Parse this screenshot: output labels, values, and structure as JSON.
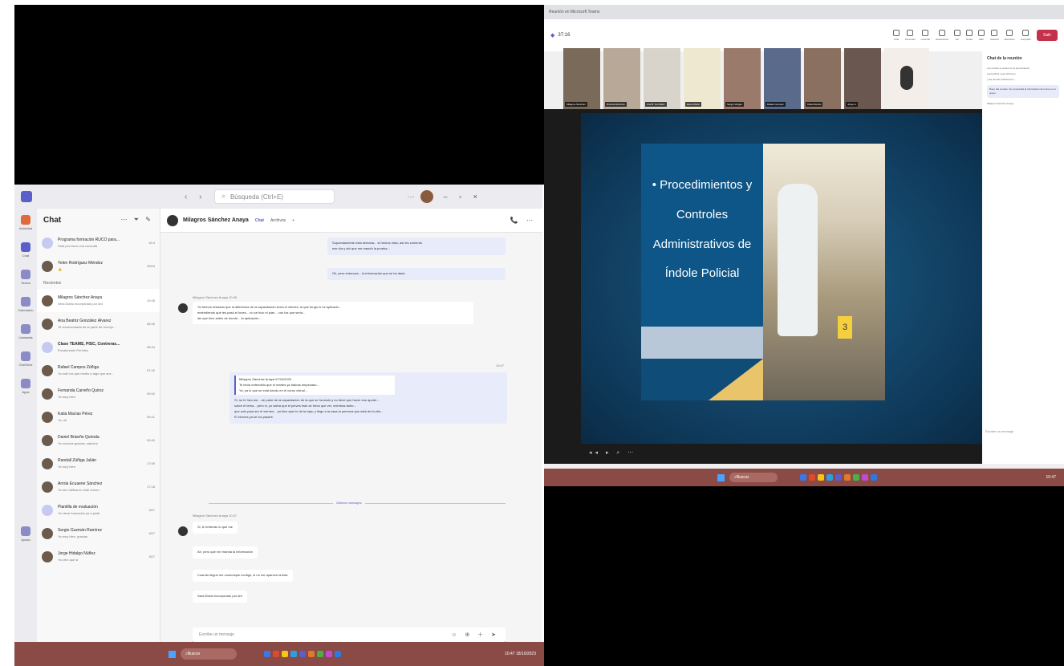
{
  "left_window": {
    "search_placeholder": "Búsqueda (Ctrl+E)",
    "rail": [
      "Actividad",
      "Chat",
      "Teams",
      "Calendario",
      "Llamadas",
      "OneDrive",
      "Apps",
      "Ayuda"
    ],
    "chat_list": {
      "title": "Chat",
      "section_recent": "Recientes",
      "items": [
        {
          "name": "Programa formación RUCO para...",
          "preview": "Hola por favor una consulta",
          "time": "16:4"
        },
        {
          "name": "Yelen Rodríguez Méndez",
          "preview": "👍",
          "time": "09/04"
        },
        {
          "name": "Milagros Sánchez Anaya",
          "preview": "Sera Diario incorporado por ahí",
          "time": "10:45",
          "selected": true
        },
        {
          "name": "Ana Beatriz González Álvarez",
          "preview": "Te recomendado de la parte de Ucenjo...",
          "time": "08:30"
        },
        {
          "name": "Clase TEAMS, PISC, Contreras...",
          "preview": "Encabezado Permiso",
          "time": "08:44",
          "bold": true
        },
        {
          "name": "Rafael Campos Zúñiga",
          "preview": "Ya subí los que medio a algo que anc...",
          "time": "07:42"
        },
        {
          "name": "Fernanda Carreño Quiroz",
          "preview": "Ya muy bien",
          "time": "09:42"
        },
        {
          "name": "Katia Macías Pérez",
          "preview": "Ya, ok",
          "time": "09:41"
        },
        {
          "name": "Daniel Briseño Quiroda",
          "preview": "Ya muchas gracias, saludos",
          "time": "09:40"
        },
        {
          "name": "Randall Zúñiga Julián",
          "preview": "Ya muy bien",
          "time": "17:59"
        },
        {
          "name": "Arrola Ecuaene Sánchez",
          "preview": "Ya me notifica en este correo",
          "time": "17:18"
        },
        {
          "name": "Plantilla de evaluación",
          "preview": "Ya viene formación ya a pedir",
          "time": "16/7"
        },
        {
          "name": "Sergio Guzmán Ramírez",
          "preview": "Ya muy bien, gracias",
          "time": "16/7"
        },
        {
          "name": "Jorge Hidalgo Núñez",
          "preview": "Ya creo que si",
          "time": "16/7"
        }
      ]
    },
    "conversation": {
      "name": "Milagros Sánchez Anaya",
      "tabs": [
        "Chat",
        "Archivos"
      ],
      "msg1_lines": [
        "Supuestamente esta semana... si hemos visto, así les comento",
        "ese día y ahí que me mandó la prueba..."
      ],
      "msg1b": "Ok, pero entonces... la información que se ha dado",
      "msg2_meta": "Milagros Sánchez Anaya  10:45",
      "msg2_lines": [
        "Ya hemos revisado que la diferencia de la capacitación sería el viernes, la que tengo lo he aplicado...",
        "entendiendo que les pasó el lunes... no se hizo el plan... con los que sería...",
        "las que hice antes de donde... la aplicación..."
      ],
      "msg3_meta": "10:47",
      "msg3_quote_head": "Milagros Sánchez Anaya  07/10/2023",
      "msg3_quote_lines": [
        "Te tenía entendido que el martes ya habías empezado...",
        "Ya, ya lo que se está dando en el curso virtual..."
      ],
      "msg3_lines": [
        "Sí, se le hizo así... de parte de la capacitación de la que se ha dado y no tiene que hacer ese aporte...",
        "sobre el tema... pero si, yo sabía que el jueves esto se tenía que ver, mientras tanto...",
        "que solo para ser el viernes... ya hice ayer lo de la caja, y llego a la casa la persona que está de la cita...",
        "El viernes ya se los pasaré."
      ],
      "unread": "Últimos mensajes",
      "msg4_meta": "Milagros Sánchez Anaya  10:47",
      "msg4_lines": [
        "Si, le entiendo lo que me",
        "Ah, pero que me manda la información",
        "Cuando llegue me comunique contigo, si no me aparece la lista",
        "Sara Diario incorporado por ahí"
      ],
      "composer_placeholder": "Escribe un mensaje"
    }
  },
  "taskbar": {
    "search": "Buscar",
    "time": "10:47",
    "date": "18/10/2023"
  },
  "right_window": {
    "tab_title": "Reunión en Microsoft Teams",
    "timer": "37:16",
    "controls": [
      "Chat",
      "Personas",
      "Levantar",
      "Reacciones",
      "Ver",
      "Notas",
      "Más",
      "Cámara",
      "Micrófono",
      "Compartir"
    ],
    "leave": "Salir",
    "participants": [
      "Milagros Sánchez",
      "Ricardo Elizondo",
      "Ana B. González",
      "Elena Marín",
      "Sergio Vargas",
      "Rafael Campos",
      "Katia Macías",
      "Jorge H."
    ],
    "slide_title": "• Procedimientos y Controles Administrativos de Índole Policial",
    "slide_marker": "3",
    "chat_panel": {
      "title": "Chat de la reunión",
      "lines": [
        "Les mando el enlace de la presentación",
        "Laura Mora a las 10:04 pm",
        "y las demás indicaciones..."
      ],
      "bubble": "Buen día a todos. Se compartirá la información del curso en el grupo.",
      "reply_author": "Milagros Sánchez Anaya",
      "input": "Escribe un mensaje"
    }
  }
}
